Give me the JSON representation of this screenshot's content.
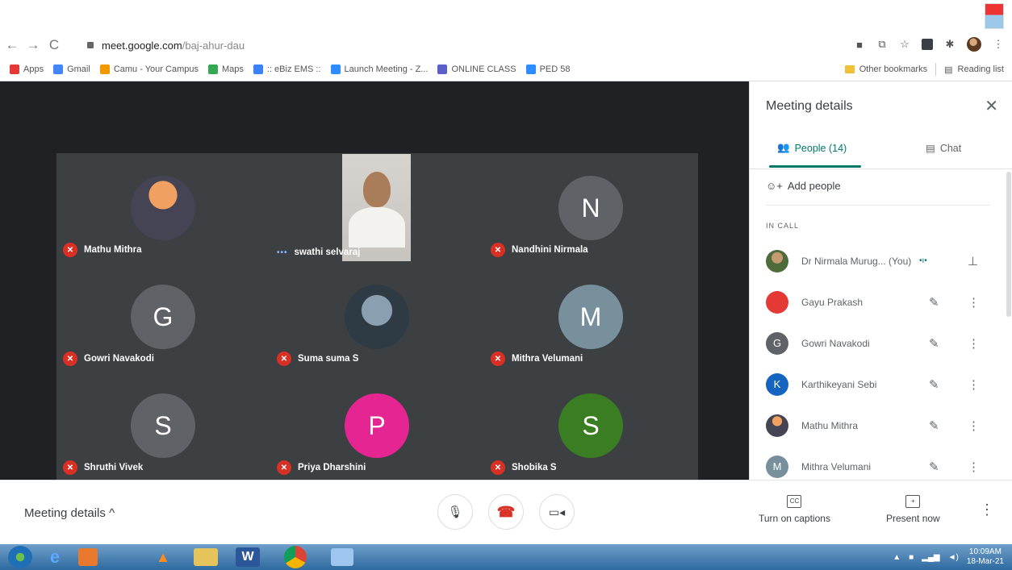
{
  "browser": {
    "url_host": "meet.google.com",
    "url_path": "/baj-ahur-dau",
    "bookmarks": [
      {
        "label": "Apps",
        "color": "#e53935"
      },
      {
        "label": "Gmail",
        "color": "#4285f4"
      },
      {
        "label": "Camu - Your Campus",
        "color": "#f29900"
      },
      {
        "label": "Maps",
        "color": "#34a853"
      },
      {
        "label": ":: eBiz EMS ::",
        "color": "#3b82f6"
      },
      {
        "label": "Launch Meeting - Z...",
        "color": "#2d8cff"
      },
      {
        "label": "ONLINE CLASS",
        "color": "#5b5fc7"
      },
      {
        "label": "PED 58",
        "color": "#2d8cff"
      }
    ],
    "other_bookmarks": "Other bookmarks",
    "reading_list": "Reading list"
  },
  "tiles": [
    {
      "name": "Mathu Mithra",
      "initial": "",
      "color": "#6a5b4e",
      "muted": true
    },
    {
      "name": "swathi selvaraj",
      "initial": "",
      "color": "",
      "muted": false
    },
    {
      "name": "Nandhini Nirmala",
      "initial": "N",
      "color": "#5f6368",
      "muted": true
    },
    {
      "name": "Gowri Navakodi",
      "initial": "G",
      "color": "#5f6368",
      "muted": true
    },
    {
      "name": "Suma suma S",
      "initial": "",
      "color": "#4a5a68",
      "muted": true
    },
    {
      "name": "Mithra Velumani",
      "initial": "M",
      "color": "#78909c",
      "muted": true
    },
    {
      "name": "Shruthi Vivek",
      "initial": "S",
      "color": "#5f6368",
      "muted": true
    },
    {
      "name": "Priya Dharshini",
      "initial": "P",
      "color": "#e52592",
      "muted": true
    },
    {
      "name": "Shobika S",
      "initial": "S",
      "color": "#3b7d23",
      "muted": true
    }
  ],
  "panel": {
    "title": "Meeting details",
    "tab_people": "People (14)",
    "tab_chat": "Chat",
    "add_people": "Add people",
    "in_call": "IN CALL",
    "people": [
      {
        "name": "Dr Nirmala Murug... (You)",
        "initial": "",
        "color": "#6b5a3e",
        "speaking": true
      },
      {
        "name": "Gayu Prakash",
        "initial": "",
        "color": "#e53935",
        "speaking": false
      },
      {
        "name": "Gowri Navakodi",
        "initial": "G",
        "color": "#5f6368",
        "speaking": false
      },
      {
        "name": "Karthikeyani Sebi",
        "initial": "K",
        "color": "#1565c0",
        "speaking": false
      },
      {
        "name": "Mathu Mithra",
        "initial": "",
        "color": "#7a6a55",
        "speaking": false
      },
      {
        "name": "Mithra Velumani",
        "initial": "M",
        "color": "#78909c",
        "speaking": false
      }
    ]
  },
  "controls": {
    "meeting_details": "Meeting details",
    "captions": "Turn on captions",
    "present": "Present now"
  },
  "taskbar": {
    "time": "10:09AM",
    "date": "18-Mar-21"
  }
}
